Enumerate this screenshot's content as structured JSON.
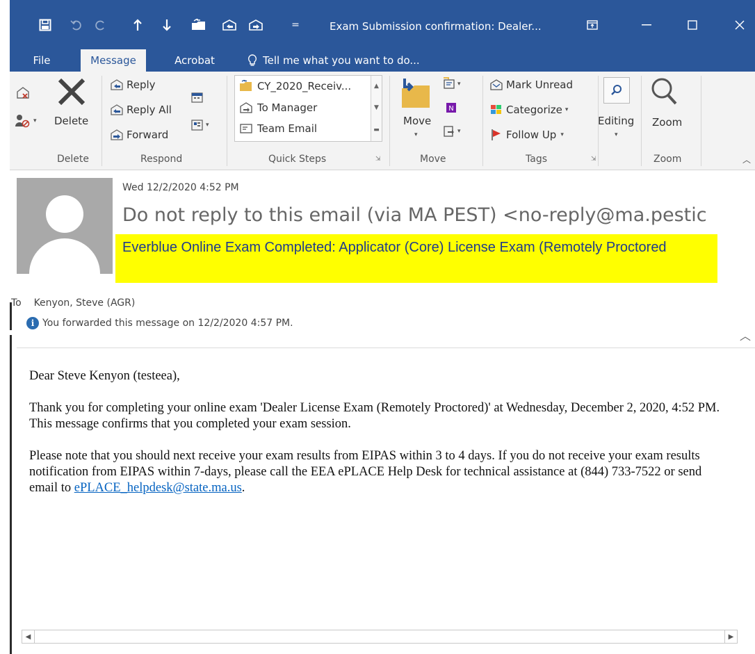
{
  "window": {
    "title": "Exam Submission confirmation: Dealer...",
    "quick_access_overflow": "="
  },
  "tabs": [
    "File",
    "Message",
    "Acrobat"
  ],
  "tell_me": "Tell me what you want to do...",
  "ribbon": {
    "delete_group": {
      "delete_label": "Delete",
      "group_label": "Delete"
    },
    "respond_group": {
      "reply": "Reply",
      "reply_all": "Reply All",
      "forward": "Forward",
      "group_label": "Respond"
    },
    "quick_steps": {
      "items": [
        "CY_2020_Receiv...",
        "To Manager",
        "Team Email"
      ],
      "group_label": "Quick Steps"
    },
    "move_group": {
      "move_label": "Move",
      "group_label": "Move"
    },
    "tags_group": {
      "mark_unread": "Mark Unread",
      "categorize": "Categorize",
      "follow_up": "Follow Up",
      "group_label": "Tags"
    },
    "editing_label": "Editing",
    "zoom_group": {
      "zoom_label": "Zoom",
      "group_label": "Zoom"
    }
  },
  "message": {
    "date": "Wed 12/2/2020 4:52 PM",
    "from": "Do not reply to this email  (via MA PEST) <no-reply@ma.pestic",
    "subject": "Everblue Online Exam Completed:  Applicator (Core) License Exam (Remotely Proctored",
    "to_label": "To",
    "to_value": "Kenyon, Steve (AGR)",
    "info": "You forwarded this message on 12/2/2020 4:57 PM."
  },
  "body": {
    "greeting": "Dear Steve Kenyon (testeea),",
    "para1": "Thank you for completing your online exam 'Dealer License Exam (Remotely Proctored)' at Wednesday, December 2, 2020, 4:52 PM. This message confirms that you completed your exam session.",
    "para2": "Please note that you should next receive your exam results from EIPAS within 3 to 4 days.  If you do not receive your exam results notification from EIPAS within 7-days, please call the EEA ePLACE Help Desk for technical assistance at (844) 733-7522 or send email to",
    "link": "ePLACE_helpdesk@state.ma.us",
    "link_suffix": "."
  },
  "colors": {
    "accent": "#2b579a",
    "subject_highlight": "#ffff00",
    "link": "#0563c1"
  }
}
